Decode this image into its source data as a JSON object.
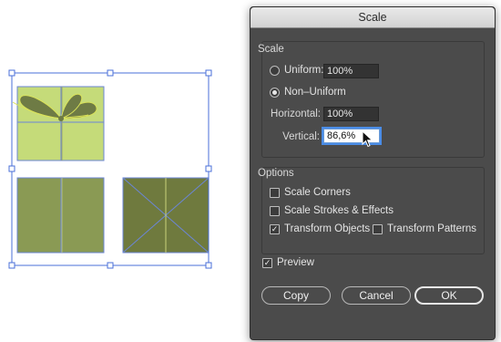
{
  "dialog": {
    "title": "Scale",
    "scale_group": {
      "label": "Scale",
      "uniform": {
        "label": "Uniform:",
        "value": "100%",
        "selected": false
      },
      "non_uniform": {
        "label": "Non–Uniform",
        "selected": true
      },
      "horizontal": {
        "label": "Horizontal:",
        "value": "100%"
      },
      "vertical": {
        "label": "Vertical:",
        "value": "86,6%"
      }
    },
    "options_group": {
      "label": "Options",
      "scale_corners": {
        "label": "Scale Corners",
        "checked": false
      },
      "scale_strokes": {
        "label": "Scale Strokes & Effects",
        "checked": false
      },
      "transform_objects": {
        "label": "Transform Objects",
        "checked": true
      },
      "transform_patterns": {
        "label": "Transform Patterns",
        "checked": false
      }
    },
    "preview": {
      "label": "Preview",
      "checked": true
    },
    "buttons": {
      "copy": "Copy",
      "cancel": "Cancel",
      "ok": "OK"
    }
  },
  "colors": {
    "dialog_bg": "#4b4b4b",
    "selection_blue": "#4a6fd8",
    "light_green": "#c5db79",
    "olive": "#8a9a54",
    "dark_olive": "#6f7a3e",
    "bow": "#6e7b45",
    "bow_outline": "#d9e25a"
  },
  "icons": {
    "cursor": "arrow-pointer-icon",
    "checkmark": "✓"
  }
}
